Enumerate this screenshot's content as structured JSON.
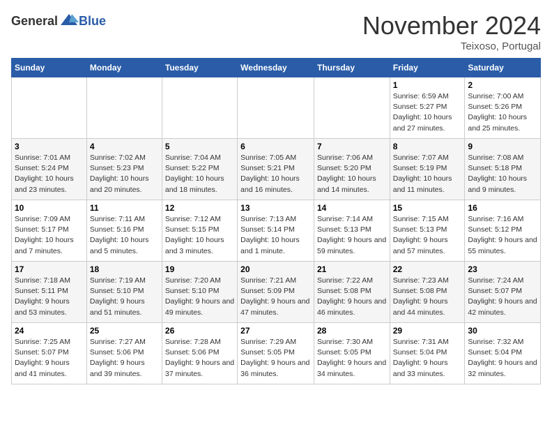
{
  "header": {
    "logo_general": "General",
    "logo_blue": "Blue",
    "month": "November 2024",
    "location": "Teixoso, Portugal"
  },
  "weekdays": [
    "Sunday",
    "Monday",
    "Tuesday",
    "Wednesday",
    "Thursday",
    "Friday",
    "Saturday"
  ],
  "weeks": [
    [
      {
        "day": "",
        "info": ""
      },
      {
        "day": "",
        "info": ""
      },
      {
        "day": "",
        "info": ""
      },
      {
        "day": "",
        "info": ""
      },
      {
        "day": "",
        "info": ""
      },
      {
        "day": "1",
        "info": "Sunrise: 6:59 AM\nSunset: 5:27 PM\nDaylight: 10 hours and 27 minutes."
      },
      {
        "day": "2",
        "info": "Sunrise: 7:00 AM\nSunset: 5:26 PM\nDaylight: 10 hours and 25 minutes."
      }
    ],
    [
      {
        "day": "3",
        "info": "Sunrise: 7:01 AM\nSunset: 5:24 PM\nDaylight: 10 hours and 23 minutes."
      },
      {
        "day": "4",
        "info": "Sunrise: 7:02 AM\nSunset: 5:23 PM\nDaylight: 10 hours and 20 minutes."
      },
      {
        "day": "5",
        "info": "Sunrise: 7:04 AM\nSunset: 5:22 PM\nDaylight: 10 hours and 18 minutes."
      },
      {
        "day": "6",
        "info": "Sunrise: 7:05 AM\nSunset: 5:21 PM\nDaylight: 10 hours and 16 minutes."
      },
      {
        "day": "7",
        "info": "Sunrise: 7:06 AM\nSunset: 5:20 PM\nDaylight: 10 hours and 14 minutes."
      },
      {
        "day": "8",
        "info": "Sunrise: 7:07 AM\nSunset: 5:19 PM\nDaylight: 10 hours and 11 minutes."
      },
      {
        "day": "9",
        "info": "Sunrise: 7:08 AM\nSunset: 5:18 PM\nDaylight: 10 hours and 9 minutes."
      }
    ],
    [
      {
        "day": "10",
        "info": "Sunrise: 7:09 AM\nSunset: 5:17 PM\nDaylight: 10 hours and 7 minutes."
      },
      {
        "day": "11",
        "info": "Sunrise: 7:11 AM\nSunset: 5:16 PM\nDaylight: 10 hours and 5 minutes."
      },
      {
        "day": "12",
        "info": "Sunrise: 7:12 AM\nSunset: 5:15 PM\nDaylight: 10 hours and 3 minutes."
      },
      {
        "day": "13",
        "info": "Sunrise: 7:13 AM\nSunset: 5:14 PM\nDaylight: 10 hours and 1 minute."
      },
      {
        "day": "14",
        "info": "Sunrise: 7:14 AM\nSunset: 5:13 PM\nDaylight: 9 hours and 59 minutes."
      },
      {
        "day": "15",
        "info": "Sunrise: 7:15 AM\nSunset: 5:13 PM\nDaylight: 9 hours and 57 minutes."
      },
      {
        "day": "16",
        "info": "Sunrise: 7:16 AM\nSunset: 5:12 PM\nDaylight: 9 hours and 55 minutes."
      }
    ],
    [
      {
        "day": "17",
        "info": "Sunrise: 7:18 AM\nSunset: 5:11 PM\nDaylight: 9 hours and 53 minutes."
      },
      {
        "day": "18",
        "info": "Sunrise: 7:19 AM\nSunset: 5:10 PM\nDaylight: 9 hours and 51 minutes."
      },
      {
        "day": "19",
        "info": "Sunrise: 7:20 AM\nSunset: 5:10 PM\nDaylight: 9 hours and 49 minutes."
      },
      {
        "day": "20",
        "info": "Sunrise: 7:21 AM\nSunset: 5:09 PM\nDaylight: 9 hours and 47 minutes."
      },
      {
        "day": "21",
        "info": "Sunrise: 7:22 AM\nSunset: 5:08 PM\nDaylight: 9 hours and 46 minutes."
      },
      {
        "day": "22",
        "info": "Sunrise: 7:23 AM\nSunset: 5:08 PM\nDaylight: 9 hours and 44 minutes."
      },
      {
        "day": "23",
        "info": "Sunrise: 7:24 AM\nSunset: 5:07 PM\nDaylight: 9 hours and 42 minutes."
      }
    ],
    [
      {
        "day": "24",
        "info": "Sunrise: 7:25 AM\nSunset: 5:07 PM\nDaylight: 9 hours and 41 minutes."
      },
      {
        "day": "25",
        "info": "Sunrise: 7:27 AM\nSunset: 5:06 PM\nDaylight: 9 hours and 39 minutes."
      },
      {
        "day": "26",
        "info": "Sunrise: 7:28 AM\nSunset: 5:06 PM\nDaylight: 9 hours and 37 minutes."
      },
      {
        "day": "27",
        "info": "Sunrise: 7:29 AM\nSunset: 5:05 PM\nDaylight: 9 hours and 36 minutes."
      },
      {
        "day": "28",
        "info": "Sunrise: 7:30 AM\nSunset: 5:05 PM\nDaylight: 9 hours and 34 minutes."
      },
      {
        "day": "29",
        "info": "Sunrise: 7:31 AM\nSunset: 5:04 PM\nDaylight: 9 hours and 33 minutes."
      },
      {
        "day": "30",
        "info": "Sunrise: 7:32 AM\nSunset: 5:04 PM\nDaylight: 9 hours and 32 minutes."
      }
    ]
  ]
}
